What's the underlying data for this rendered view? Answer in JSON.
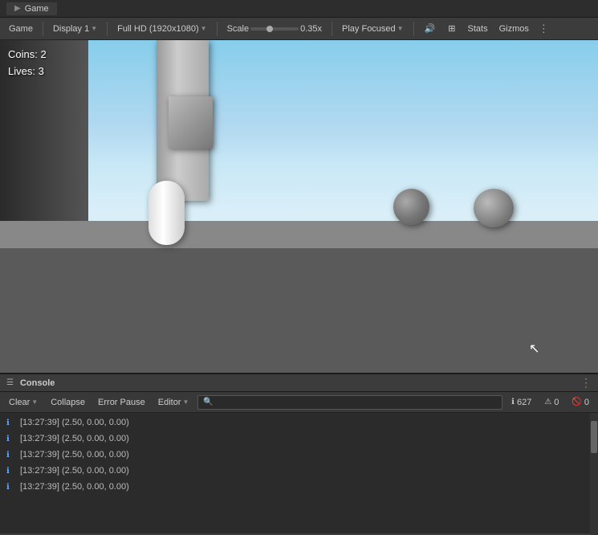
{
  "titlebar": {
    "tab_label": "Game",
    "tab_icon": "▶"
  },
  "toolbar": {
    "game_label": "Game",
    "display_label": "Display 1",
    "resolution_label": "Full HD (1920x1080)",
    "scale_label": "Scale",
    "scale_value": "0.35x",
    "play_focused_label": "Play Focused",
    "volume_icon": "🔊",
    "grid_icon": "⊞",
    "stats_label": "Stats",
    "gizmos_label": "Gizmos",
    "more_icon": "⋮"
  },
  "hud": {
    "coins": "Coins: 2",
    "lives": "Lives: 3"
  },
  "console": {
    "title": "Console",
    "icon": "☰",
    "more_icon": "⋮",
    "clear_label": "Clear",
    "collapse_label": "Collapse",
    "error_pause_label": "Error Pause",
    "editor_label": "Editor",
    "search_placeholder": "🔍",
    "badge_count": "627",
    "badge_warn": "0",
    "badge_error": "0",
    "messages": [
      "[13:27:39] (2.50, 0.00, 0.00)",
      "[13:27:39] (2.50, 0.00, 0.00)",
      "[13:27:39] (2.50, 0.00, 0.00)",
      "[13:27:39] (2.50, 0.00, 0.00)",
      "[13:27:39] (2.50, 0.00, 0.00)"
    ]
  }
}
